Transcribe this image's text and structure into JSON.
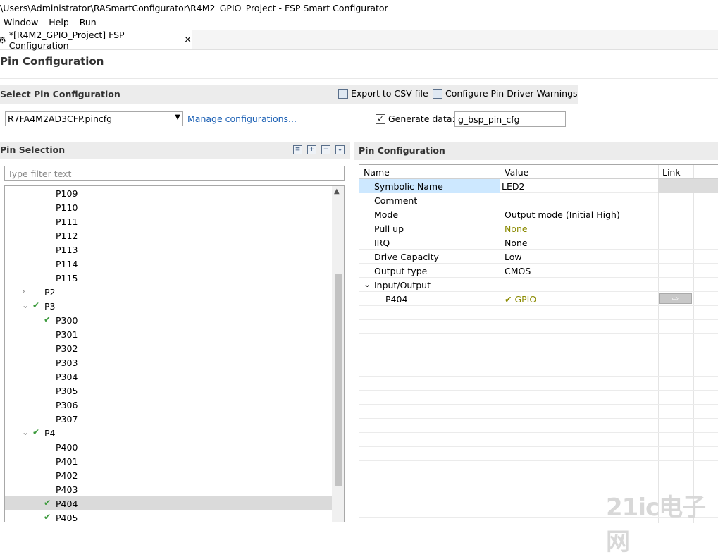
{
  "window": {
    "title": "\\Users\\Administrator\\RASmartConfigurator\\R4M2_GPIO_Project - FSP Smart Configurator"
  },
  "menu": [
    "Window",
    "Help",
    "Run"
  ],
  "editor_tab": {
    "label": "*[R4M2_GPIO_Project] FSP Configuration",
    "close": "×"
  },
  "page_title": "Pin Configuration",
  "select_config": {
    "title": "Select Pin Configuration",
    "export_label": "Export to CSV file",
    "warnings_label": "Configure Pin Driver Warnings",
    "selected_file": "R7FA4M2AD3CFP.pincfg",
    "manage_link": "Manage configurations...",
    "generate_label": "Generate data:",
    "generate_checked": true,
    "generate_value": "g_bsp_pin_cfg"
  },
  "pin_selection": {
    "title": "Pin Selection",
    "filter_placeholder": "Type filter text",
    "tree": [
      {
        "label": "P109",
        "level": 2,
        "checked": false
      },
      {
        "label": "P110",
        "level": 2,
        "checked": false
      },
      {
        "label": "P111",
        "level": 2,
        "checked": false
      },
      {
        "label": "P112",
        "level": 2,
        "checked": false
      },
      {
        "label": "P113",
        "level": 2,
        "checked": false
      },
      {
        "label": "P114",
        "level": 2,
        "checked": false
      },
      {
        "label": "P115",
        "level": 2,
        "checked": false
      },
      {
        "label": "P2",
        "level": 1,
        "checked": false,
        "expanded": false
      },
      {
        "label": "P3",
        "level": 1,
        "checked": true,
        "expanded": true
      },
      {
        "label": "P300",
        "level": 2,
        "checked": true
      },
      {
        "label": "P301",
        "level": 2,
        "checked": false
      },
      {
        "label": "P302",
        "level": 2,
        "checked": false
      },
      {
        "label": "P303",
        "level": 2,
        "checked": false
      },
      {
        "label": "P304",
        "level": 2,
        "checked": false
      },
      {
        "label": "P305",
        "level": 2,
        "checked": false
      },
      {
        "label": "P306",
        "level": 2,
        "checked": false
      },
      {
        "label": "P307",
        "level": 2,
        "checked": false
      },
      {
        "label": "P4",
        "level": 1,
        "checked": true,
        "expanded": true
      },
      {
        "label": "P400",
        "level": 2,
        "checked": false
      },
      {
        "label": "P401",
        "level": 2,
        "checked": false
      },
      {
        "label": "P402",
        "level": 2,
        "checked": false
      },
      {
        "label": "P403",
        "level": 2,
        "checked": false
      },
      {
        "label": "P404",
        "level": 2,
        "checked": true,
        "selected": true
      },
      {
        "label": "P405",
        "level": 2,
        "checked": true
      }
    ]
  },
  "pin_config": {
    "title": "Pin Configuration",
    "columns": [
      "Name",
      "Value",
      "Link"
    ],
    "rows": [
      {
        "name": "Symbolic Name",
        "value": "LED2"
      },
      {
        "name": "Comment",
        "value": ""
      },
      {
        "name": "Mode",
        "value": "Output mode (Initial High)"
      },
      {
        "name": "Pull up",
        "value": "None"
      },
      {
        "name": "IRQ",
        "value": "None"
      },
      {
        "name": "Drive Capacity",
        "value": "Low"
      },
      {
        "name": "Output type",
        "value": "CMOS"
      },
      {
        "name": "Input/Output",
        "value": ""
      },
      {
        "name": "P404",
        "value": "GPIO"
      }
    ],
    "link_arrow": "⇨"
  },
  "watermark": "21ic电子网",
  "colors": {
    "selection_blue": "#cde8ff",
    "check_green": "#3c9a3c",
    "olive_text": "#8a8a00",
    "link_blue": "#1a5fb4"
  }
}
